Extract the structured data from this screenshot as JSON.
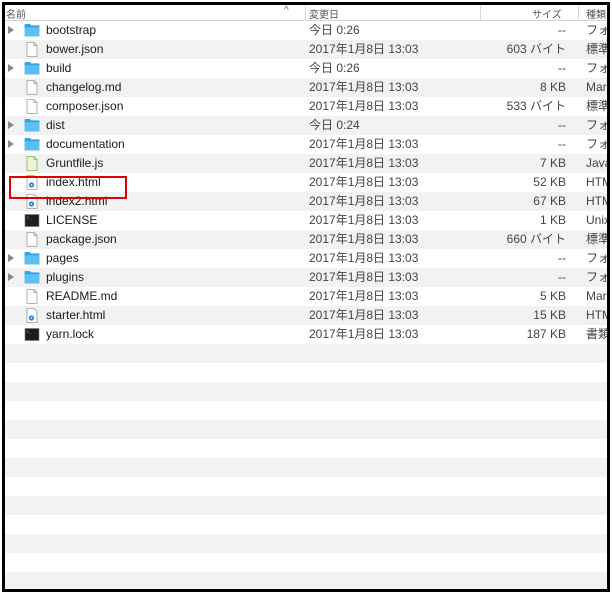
{
  "columns": {
    "name": "名前",
    "date": "変更日",
    "size": "サイズ",
    "kind": "種類"
  },
  "sort_indicator": "^",
  "files": [
    {
      "name": "bootstrap",
      "date": "今日 0:26",
      "size": "--",
      "kind": "フォルダ",
      "icon": "folder-icon",
      "folder": true
    },
    {
      "name": "bower.json",
      "date": "2017年1月8日 13:03",
      "size": "603 バイト",
      "kind": "標準テキスト",
      "icon": "document-icon",
      "folder": false
    },
    {
      "name": "build",
      "date": "今日 0:26",
      "size": "--",
      "kind": "フォルダ",
      "icon": "folder-icon",
      "folder": true
    },
    {
      "name": "changelog.md",
      "date": "2017年1月8日 13:03",
      "size": "8 KB",
      "kind": "Markdown",
      "icon": "document-icon",
      "folder": false
    },
    {
      "name": "composer.json",
      "date": "2017年1月8日 13:03",
      "size": "533 バイト",
      "kind": "標準テキスト",
      "icon": "document-icon",
      "folder": false
    },
    {
      "name": "dist",
      "date": "今日 0:24",
      "size": "--",
      "kind": "フォルダ",
      "icon": "folder-icon",
      "folder": true
    },
    {
      "name": "documentation",
      "date": "2017年1月8日 13:03",
      "size": "--",
      "kind": "フォルダ",
      "icon": "folder-icon",
      "folder": true
    },
    {
      "name": "Gruntfile.js",
      "date": "2017年1月8日 13:03",
      "size": "7 KB",
      "kind": "JavaScript",
      "icon": "javascript-file-icon",
      "folder": false
    },
    {
      "name": "index.html",
      "date": "2017年1月8日 13:03",
      "size": "52 KB",
      "kind": "HTML",
      "icon": "html-file-icon",
      "folder": false
    },
    {
      "name": "index2.html",
      "date": "2017年1月8日 13:03",
      "size": "67 KB",
      "kind": "HTML",
      "icon": "html-file-icon",
      "folder": false
    },
    {
      "name": "LICENSE",
      "date": "2017年1月8日 13:03",
      "size": "1 KB",
      "kind": "Unix",
      "icon": "terminal-file-icon",
      "folder": false
    },
    {
      "name": "package.json",
      "date": "2017年1月8日 13:03",
      "size": "660 バイト",
      "kind": "標準テキスト",
      "icon": "document-icon",
      "folder": false
    },
    {
      "name": "pages",
      "date": "2017年1月8日 13:03",
      "size": "--",
      "kind": "フォルダ",
      "icon": "folder-icon",
      "folder": true
    },
    {
      "name": "plugins",
      "date": "2017年1月8日 13:03",
      "size": "--",
      "kind": "フォルダ",
      "icon": "folder-icon",
      "folder": true
    },
    {
      "name": "README.md",
      "date": "2017年1月8日 13:03",
      "size": "5 KB",
      "kind": "Markdown",
      "icon": "document-icon",
      "folder": false
    },
    {
      "name": "starter.html",
      "date": "2017年1月8日 13:03",
      "size": "15 KB",
      "kind": "HTML",
      "icon": "html-file-icon",
      "folder": false
    },
    {
      "name": "yarn.lock",
      "date": "2017年1月8日 13:03",
      "size": "187 KB",
      "kind": "書類",
      "icon": "terminal-file-icon",
      "folder": false
    }
  ],
  "empty_rows": 13,
  "highlighted_file": "index.html",
  "colors": {
    "folder": "#2ea6e8",
    "highlight": "#e30000",
    "stripe": "#f2f2f2"
  }
}
